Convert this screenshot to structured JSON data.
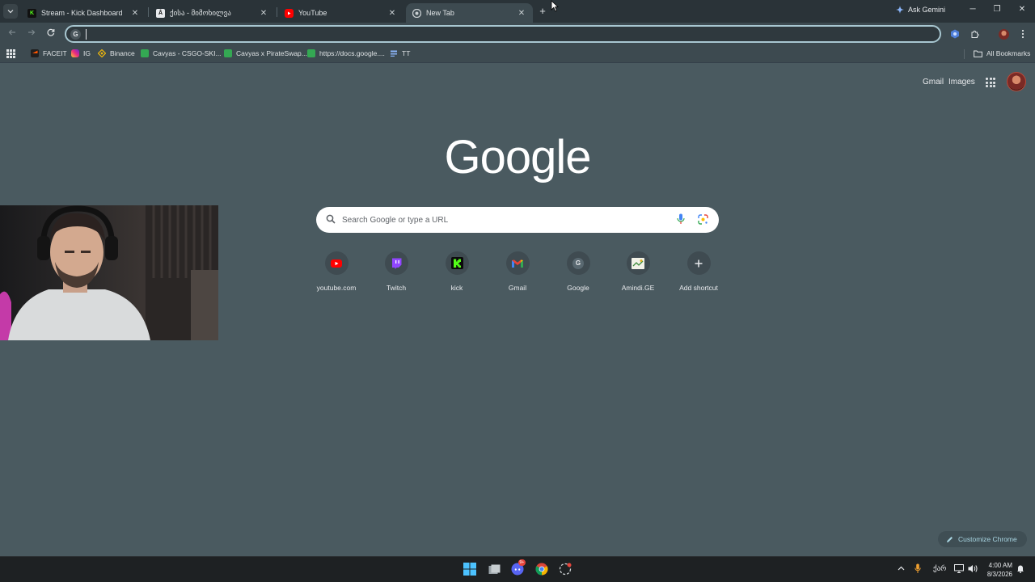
{
  "tabs": [
    {
      "title": "Stream - Kick Dashboard",
      "favicon": "kick-icon",
      "active": false
    },
    {
      "title": "ქისა - მიმოხილვა",
      "favicon": "kisa-icon",
      "active": false
    },
    {
      "title": "YouTube",
      "favicon": "youtube-icon",
      "active": false
    },
    {
      "title": "New Tab",
      "favicon": "chrome-icon",
      "active": true
    }
  ],
  "gemini_label": "Ask Gemini",
  "omnibox": {
    "value": "",
    "placeholder": ""
  },
  "bookmarks": [
    {
      "label": "FACEIT",
      "icon": "faceit-icon",
      "color": "#ff5500"
    },
    {
      "label": "IG",
      "icon": "instagram-icon",
      "color": "#e1306c"
    },
    {
      "label": "Binance",
      "icon": "binance-icon",
      "color": "#f0b90b"
    },
    {
      "label": "Cavyas - CSGO-SKI...",
      "icon": "sheets-icon",
      "color": "#34a853"
    },
    {
      "label": "Cavyas x PirateSwap...",
      "icon": "sheets-icon",
      "color": "#34a853"
    },
    {
      "label": "https://docs.google....",
      "icon": "sheets-icon",
      "color": "#34a853"
    },
    {
      "label": "TT",
      "icon": "tt-icon",
      "color": "#8ab4f8"
    }
  ],
  "all_bookmarks": "All Bookmarks",
  "top_links": {
    "gmail": "Gmail",
    "images": "Images"
  },
  "search": {
    "placeholder": "Search Google or type a URL"
  },
  "shortcuts": [
    {
      "label": "youtube.com",
      "icon": "youtube-icon"
    },
    {
      "label": "Twitch",
      "icon": "twitch-icon"
    },
    {
      "label": "kick",
      "icon": "kick-icon"
    },
    {
      "label": "Gmail",
      "icon": "gmail-icon"
    },
    {
      "label": "Google",
      "icon": "google-g-icon"
    },
    {
      "label": "Amindi.GE",
      "icon": "amindi-icon"
    },
    {
      "label": "Add shortcut",
      "icon": "plus-icon"
    }
  ],
  "customize_label": "Customize Chrome",
  "taskbar": {
    "lang": "ქარ",
    "time": "4:00 AM",
    "date": "8/3/2026",
    "discord_badge": "9+"
  }
}
